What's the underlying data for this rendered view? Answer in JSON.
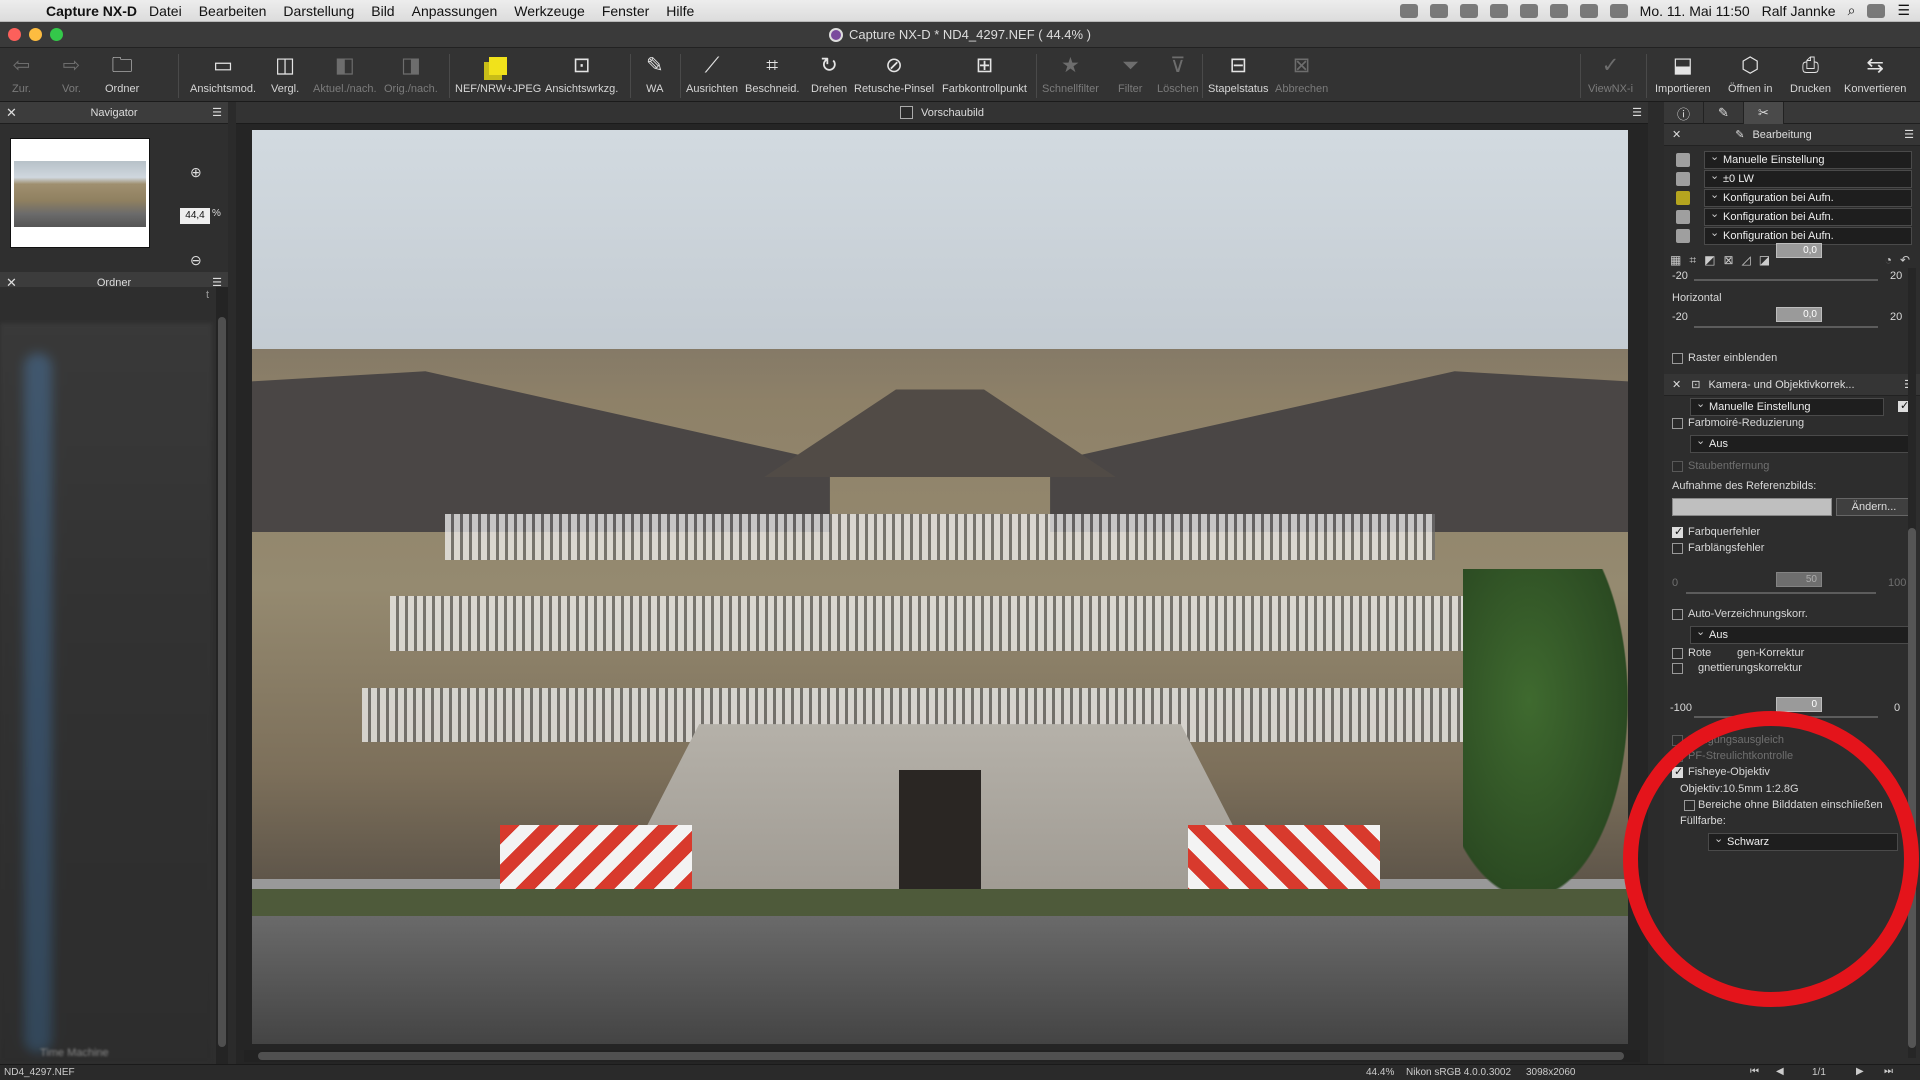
{
  "menubar": {
    "app_name": "Capture NX-D",
    "items": [
      "Datei",
      "Bearbeiten",
      "Darstellung",
      "Bild",
      "Anpassungen",
      "Werkzeuge",
      "Fenster",
      "Hilfe"
    ],
    "clock": "Mo. 11. Mai  11:50",
    "user": "Ralf Jannke"
  },
  "window": {
    "title": "Capture NX-D     * ND4_4297.NEF ( 44.4% )"
  },
  "toolbar": {
    "back": "Zur.",
    "forward": "Vor.",
    "folder": "Ordner",
    "view_mode": "Ansichtsmod.",
    "compare": "Vergl.",
    "before_after": "Aktuel./nach.",
    "orig_after": "Orig./nach.",
    "nef_jpeg": "NEF/NRW+JPEG",
    "view_tools": "Ansichtswrkzg.",
    "wb": "WA",
    "straighten": "Ausrichten",
    "crop": "Beschneid.",
    "rotate": "Drehen",
    "retouch": "Retusche-Pinsel",
    "control_point": "Farbkontrollpunkt",
    "quick_filter": "Schnellfilter",
    "filter": "Filter",
    "delete": "Löschen",
    "batch_status": "Stapelstatus",
    "cancel": "Abbrechen",
    "viewnx": "ViewNX-i",
    "import": "Importieren",
    "open_in": "Öffnen in",
    "print": "Drucken",
    "convert": "Konvertieren"
  },
  "navigator": {
    "title": "Navigator",
    "zoom_value": "44,4",
    "zoom_unit": "%"
  },
  "folder_panel": {
    "title": "Ordner",
    "clipped_label": "t",
    "bottom_label": "Time Machine"
  },
  "center": {
    "preview_label": "Vorschaubild"
  },
  "edit_panel": {
    "title": "Bearbeitung",
    "manual_setting": "Manuelle Einstellung",
    "exposure": "±0 LW",
    "config_rows": [
      "Konfiguration bei Aufn.",
      "Konfiguration bei Aufn.",
      "Konfiguration bei Aufn."
    ],
    "vertical_min": "-20",
    "vertical_max": "20",
    "vertical_value": "0,0",
    "horizontal_label": "Horizontal",
    "horizontal_min": "-20",
    "horizontal_max": "20",
    "horizontal_value": "0,0",
    "show_grid": "Raster einblenden",
    "camera_lens_title": "Kamera- und Objektivkorrek...",
    "camera_manual": "Manuelle Einstellung",
    "moire": "Farbmoiré-Reduzierung",
    "moire_value": "Aus",
    "dust": "Staubentfernung",
    "ref_image": "Aufnahme des Referenzbilds:",
    "change_button": "Ändern...",
    "lateral_ca": "Farbquerfehler",
    "axial_ca": "Farblängsfehler",
    "axial_min": "0",
    "axial_max": "100",
    "axial_value": "50",
    "auto_distortion": "Auto-Verzeichnungskorr.",
    "auto_distortion_value": "Aus",
    "red_eye": "Rote-Augen-Korrektur",
    "red_eye_visible": "Rote",
    "red_eye_tail": "gen-Korrektur",
    "vignette": "Vignettierungskorrektur",
    "vignette_visible": "gnettierungskorrektur",
    "vignette_min": "-100",
    "vignette_max": "0",
    "vignette_value": "0",
    "diffraction": "Beugungsausgleich",
    "pf_flare": "PF-Streulichtkontrolle",
    "fisheye": "Fisheye-Objektiv",
    "lens": "Objektiv:10.5mm 1:2.8G",
    "include_areas": "Bereiche ohne Bilddaten einschließen",
    "fill_color_label": "Füllfarbe:",
    "fill_color": "Schwarz"
  },
  "status": {
    "filename": "ND4_4297.NEF",
    "zoom": "44.4%",
    "profile": "Nikon sRGB 4.0.0.3002",
    "dimensions": "3098x2060",
    "page": "1/1"
  },
  "colors": {
    "annotation_circle": "#e4141b",
    "accent_yellow": "#f1e21b"
  },
  "icons": [
    "apple-icon",
    "back-arrow-icon",
    "forward-arrow-icon",
    "folder-icon",
    "zoom-in-icon",
    "zoom-out-icon",
    "gear-icon",
    "close-icon"
  ]
}
